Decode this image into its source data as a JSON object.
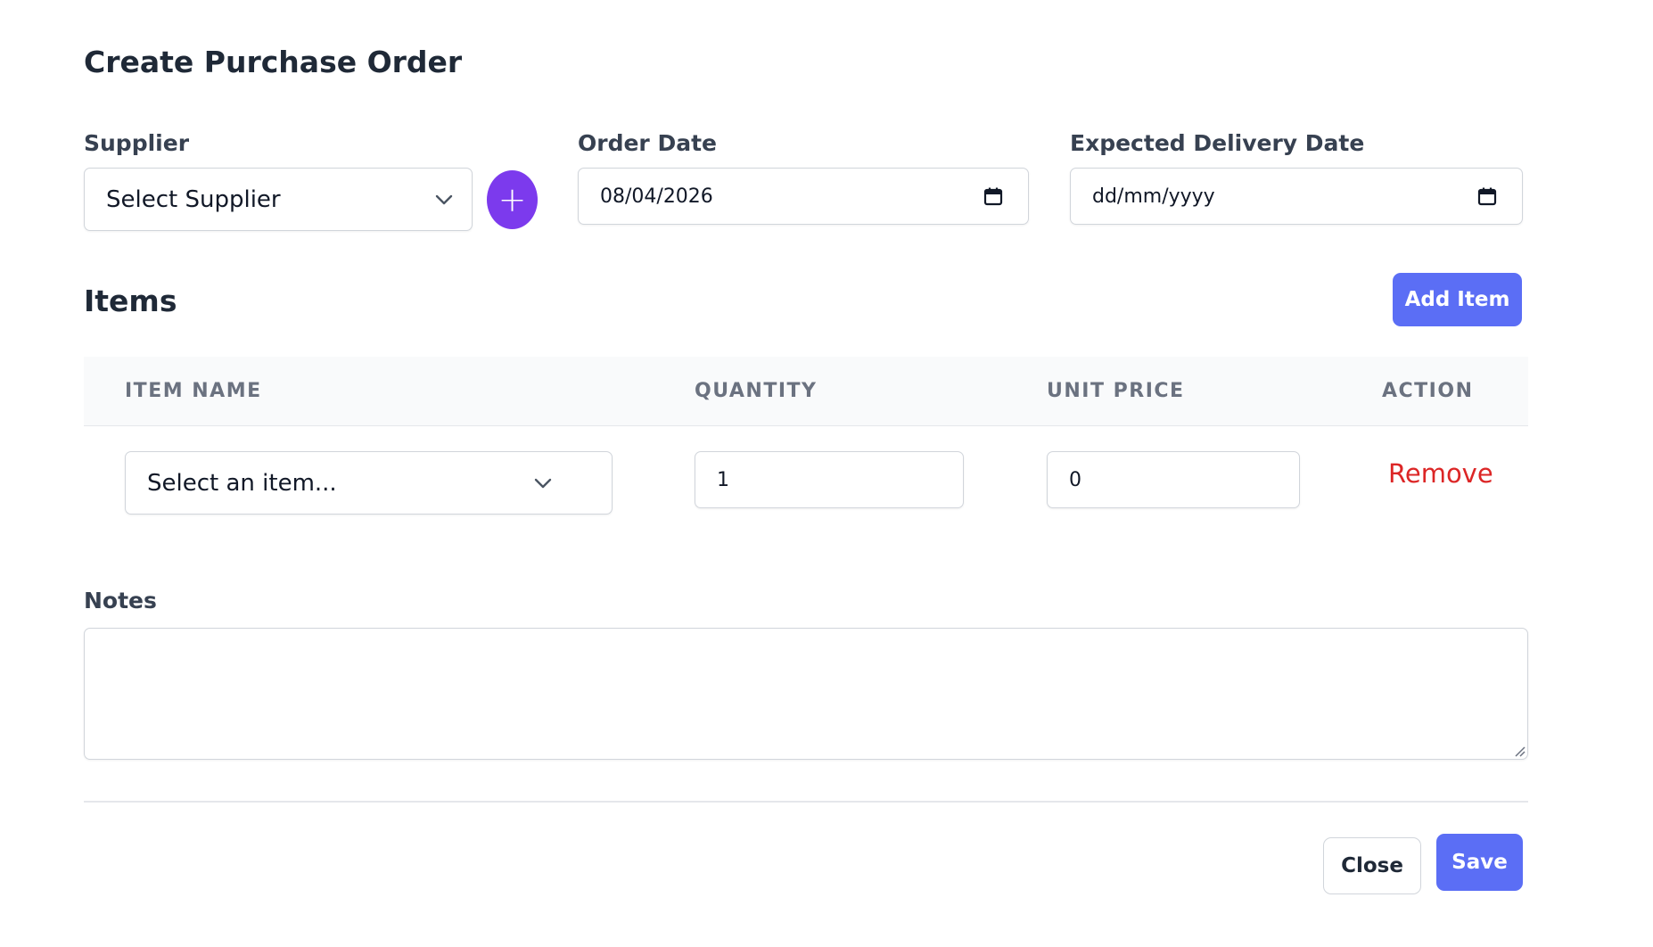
{
  "modal": {
    "title": "Create Purchase Order"
  },
  "supplier": {
    "label": "Supplier",
    "selected": "Select Supplier",
    "add_button_label": "+"
  },
  "order_date": {
    "label": "Order Date",
    "value": "08/04/2026"
  },
  "expected_delivery_date": {
    "label": "Expected Delivery Date",
    "value": "dd/mm/yyyy"
  },
  "items": {
    "title": "Items",
    "add_item_label": "Add Item",
    "columns": [
      "ITEM NAME",
      "QUANTITY",
      "UNIT PRICE",
      "ACTION"
    ],
    "rows": [
      {
        "item_name": "Select an item...",
        "quantity": "1",
        "unit_price": "0",
        "action_label": "Remove"
      }
    ]
  },
  "notes": {
    "label": "Notes",
    "value": ""
  },
  "footer": {
    "close_label": "Close",
    "save_label": "Save"
  },
  "colors": {
    "primary": "#5b6ef5",
    "accent_purple": "#7c3aed",
    "danger": "#dc2626"
  },
  "icons": {
    "dropdown": "chevron-down-icon",
    "date": "calendar-icon",
    "add": "plus-icon",
    "resize": "resize-grip-icon"
  }
}
